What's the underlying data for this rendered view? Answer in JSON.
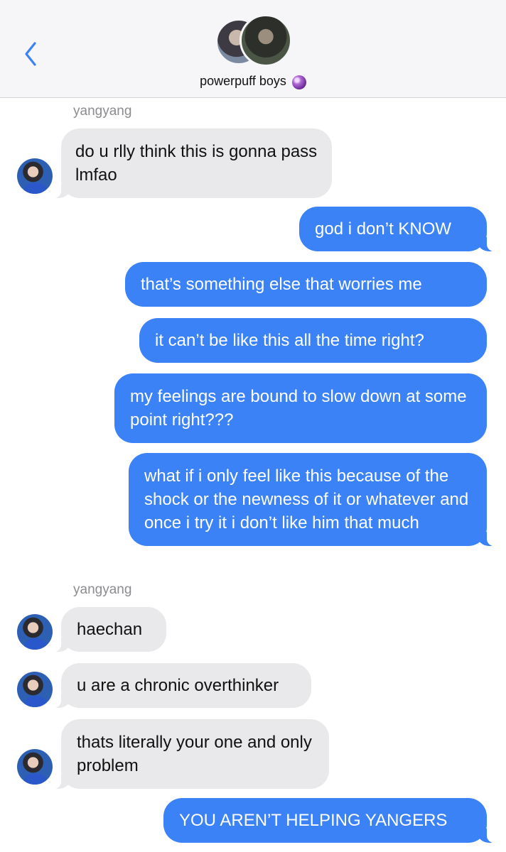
{
  "header": {
    "back_icon": "chevron-left-icon",
    "title": "powerpuff boys",
    "title_emoji": "crystal-ball-icon",
    "accent_color": "#3a82f6"
  },
  "messages": [
    {
      "sender": "yangyang",
      "text": "do u rlly think this is gonna pass lmfao"
    },
    {
      "sender": "me",
      "text": "god i don’t KNOW"
    },
    {
      "sender": "me",
      "text": "that’s something else that worries me"
    },
    {
      "sender": "me",
      "text": "it can’t be like this all the time right?"
    },
    {
      "sender": "me",
      "text": "my feelings are bound to slow down at some point right???"
    },
    {
      "sender": "me",
      "text": "what if i only feel like this because of the shock or the newness of it or whatever and once i try it i don’t like him that much"
    },
    {
      "sender": "yangyang",
      "text": "haechan"
    },
    {
      "sender": "yangyang",
      "text": "u are a chronic overthinker"
    },
    {
      "sender": "yangyang",
      "text": "thats literally your one and only problem"
    },
    {
      "sender": "me",
      "text": "YOU AREN’T HELPING YANGERS"
    }
  ],
  "sender_labels": [
    "yangyang",
    "yangyang"
  ],
  "colors": {
    "incoming_bubble": "#e9e9eb",
    "outgoing_bubble": "#3a82f6",
    "sender_label": "#8b8b90"
  }
}
